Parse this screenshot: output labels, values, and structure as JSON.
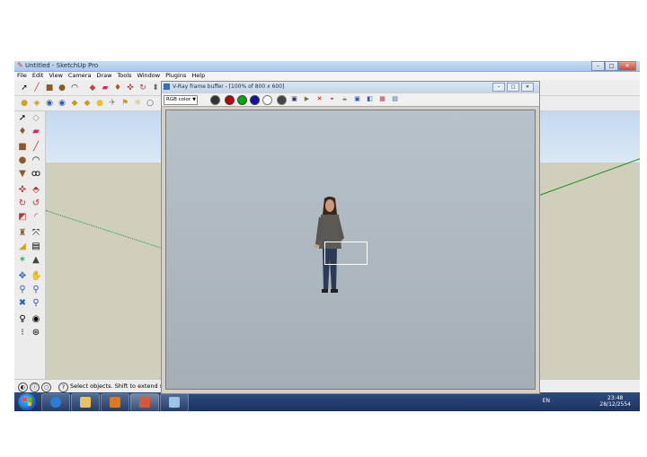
{
  "window": {
    "title": "Untitled - SketchUp Pro",
    "controls": [
      "–",
      "□",
      "✕"
    ]
  },
  "menu": [
    "File",
    "Edit",
    "View",
    "Camera",
    "Draw",
    "Tools",
    "Window",
    "Plugins",
    "Help"
  ],
  "status": {
    "text": "Select objects. Shift to extend sele"
  },
  "vray": {
    "title": "V-Ray frame buffer - [100% of 800 x 600]",
    "channel": "RGB color",
    "controls": [
      "–",
      "□",
      "✕"
    ]
  },
  "taskbar": {
    "lang": "EN",
    "time": "23:48",
    "date": "28/12/2554"
  },
  "colors": {
    "taskbar": "#1b335e",
    "render_bg": "#aeb7bf",
    "ground": "#cfcfbb",
    "sky": "#c4d9f0"
  }
}
